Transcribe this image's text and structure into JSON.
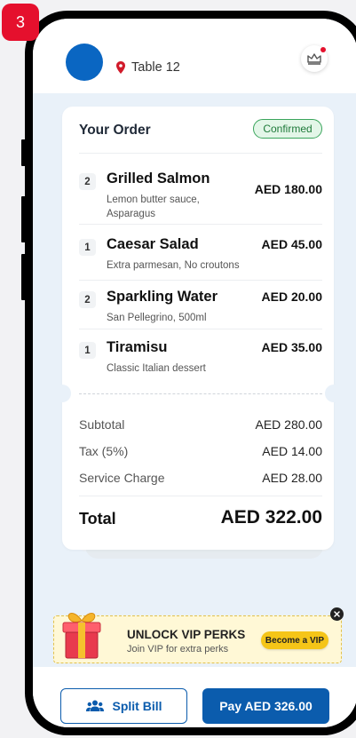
{
  "step_badge": "3",
  "header": {
    "table_label": "Table 12"
  },
  "order": {
    "title": "Your Order",
    "status": "Confirmed",
    "items": [
      {
        "qty": "2",
        "name": "Grilled Salmon",
        "desc": "Lemon butter sauce, Asparagus",
        "price": "AED 180.00"
      },
      {
        "qty": "1",
        "name": "Caesar Salad",
        "desc": "Extra parmesan, No croutons",
        "price": "AED 45.00"
      },
      {
        "qty": "2",
        "name": "Sparkling Water",
        "desc": "San Pellegrino, 500ml",
        "price": "AED 20.00"
      },
      {
        "qty": "1",
        "name": "Tiramisu",
        "desc": "Classic Italian dessert",
        "price": "AED 35.00"
      }
    ]
  },
  "summary": {
    "subtotal_label": "Subtotal",
    "subtotal_value": "AED 280.00",
    "tax_label": "Tax (5%)",
    "tax_value": "AED 14.00",
    "service_label": "Service Charge",
    "service_value": "AED 28.00",
    "total_label": "Total",
    "total_value": "AED 322.00"
  },
  "vip": {
    "title": "UNLOCK VIP PERKS",
    "subtitle": "Join VIP for extra perks",
    "button": "Become a VIP"
  },
  "actions": {
    "split_bill": "Split Bill",
    "pay": "Pay AED 326.00"
  },
  "colors": {
    "primary": "#0b5cad",
    "accent_red": "#e5102d",
    "confirmed_green": "#3aa55c",
    "vip_yellow": "#f5c518"
  },
  "icons": {
    "location": "map-pin-icon",
    "crown": "crown-icon",
    "gift": "gift-icon",
    "close": "close-icon",
    "users": "users-icon"
  }
}
